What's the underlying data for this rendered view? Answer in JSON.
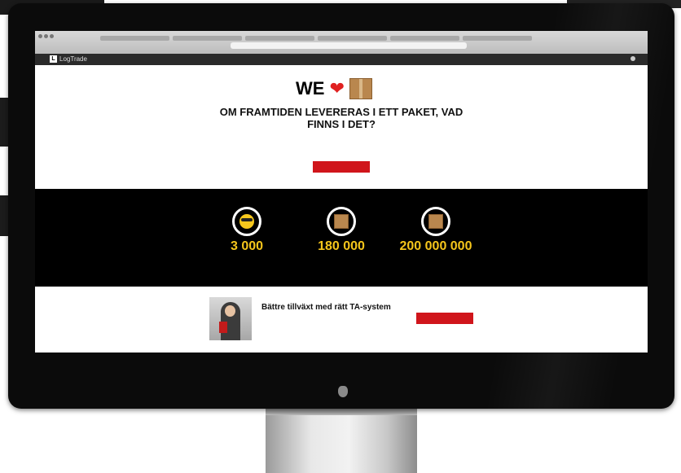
{
  "browser": {
    "url": ""
  },
  "site_nav": {
    "logo_mark": "L",
    "logo_text": "LogTrade",
    "items": [
      "",
      "",
      "",
      "",
      "",
      ""
    ],
    "user_label": ""
  },
  "hero": {
    "we_text": "WE",
    "heart_icon": "❤",
    "title": "OM FRAMTIDEN LEVERERAS I ETT PAKET, VAD FINNS I DET?",
    "body": "",
    "button_label": ""
  },
  "stats": [
    {
      "icon": "sunglasses-icon",
      "value": "3 000",
      "label": ""
    },
    {
      "icon": "box-icon",
      "value": "180 000",
      "label": ""
    },
    {
      "icon": "box-icon",
      "value": "200 000 000",
      "label": ""
    }
  ],
  "promo": {
    "title": "Bättre tillväxt med rätt TA-system",
    "text": "",
    "button_label": ""
  },
  "colors": {
    "accent_red": "#d0151b",
    "stat_yellow": "#f5c51b",
    "heart_red": "#e02020"
  }
}
